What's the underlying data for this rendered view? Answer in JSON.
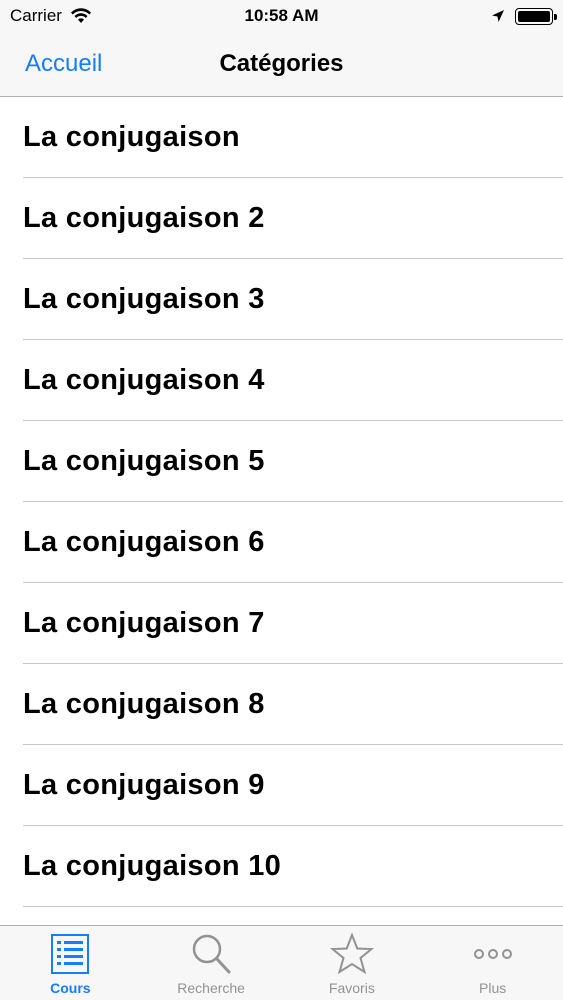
{
  "status_bar": {
    "carrier": "Carrier",
    "time": "10:58 AM",
    "wifi_icon": "wifi-icon",
    "location_icon": "location-arrow-icon",
    "battery_icon": "battery-full-icon"
  },
  "nav": {
    "back_label": "Accueil",
    "title": "Catégories"
  },
  "list": {
    "items": [
      {
        "label": "La conjugaison"
      },
      {
        "label": "La conjugaison 2"
      },
      {
        "label": "La conjugaison 3"
      },
      {
        "label": "La conjugaison 4"
      },
      {
        "label": "La conjugaison 5"
      },
      {
        "label": "La conjugaison 6"
      },
      {
        "label": "La conjugaison 7"
      },
      {
        "label": "La conjugaison 8"
      },
      {
        "label": "La conjugaison 9"
      },
      {
        "label": "La conjugaison 10"
      }
    ]
  },
  "tab_bar": {
    "tabs": [
      {
        "label": "Cours",
        "icon": "list-icon",
        "active": true
      },
      {
        "label": "Recherche",
        "icon": "search-icon",
        "active": false
      },
      {
        "label": "Favoris",
        "icon": "star-icon",
        "active": false
      },
      {
        "label": "Plus",
        "icon": "more-icon",
        "active": false
      }
    ]
  },
  "colors": {
    "accent": "#157efb",
    "inactive": "#929292",
    "bar_background": "#f7f7f7"
  }
}
